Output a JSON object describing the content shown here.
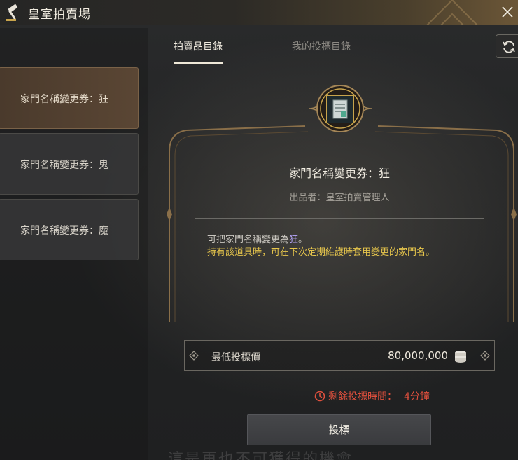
{
  "window": {
    "title": "皇室拍賣場",
    "logo_icon": "gavel-icon",
    "close_icon": "close-icon"
  },
  "tabs": [
    {
      "label": "拍賣品目錄",
      "active": true
    },
    {
      "label": "我的投標目錄",
      "active": false
    }
  ],
  "refresh_icon": "refresh-icon",
  "auction_list": [
    {
      "label": "家門名稱變更券：狂",
      "selected": true
    },
    {
      "label": "家門名稱變更券：鬼",
      "selected": false
    },
    {
      "label": "家門名稱變更券：魔",
      "selected": false
    }
  ],
  "detail": {
    "item_name": "家門名稱變更券：狂",
    "seller": "出品者：皇室拍賣管理人",
    "description_prefix": "可把家門名稱變更為",
    "description_highlight": "狂",
    "description_suffix": "。",
    "description_line2": "持有該道具時，可在下次定期維護時套用變更的家門名。",
    "min_bid_label": "最低投標價",
    "min_bid_value": "80,000,000",
    "currency_icon": "silver-coin-icon",
    "time_left_label": "剩餘投標時間：",
    "time_left_value": "4分鐘",
    "bid_button": "投標",
    "background_text": "這是再也不可獲得的機會。"
  },
  "colors": {
    "accent_gold": "#c8a44c",
    "timer_red": "#e0503d",
    "highlight_purple": "#b9a8ff",
    "desc_yellow": "#e7c64c"
  }
}
